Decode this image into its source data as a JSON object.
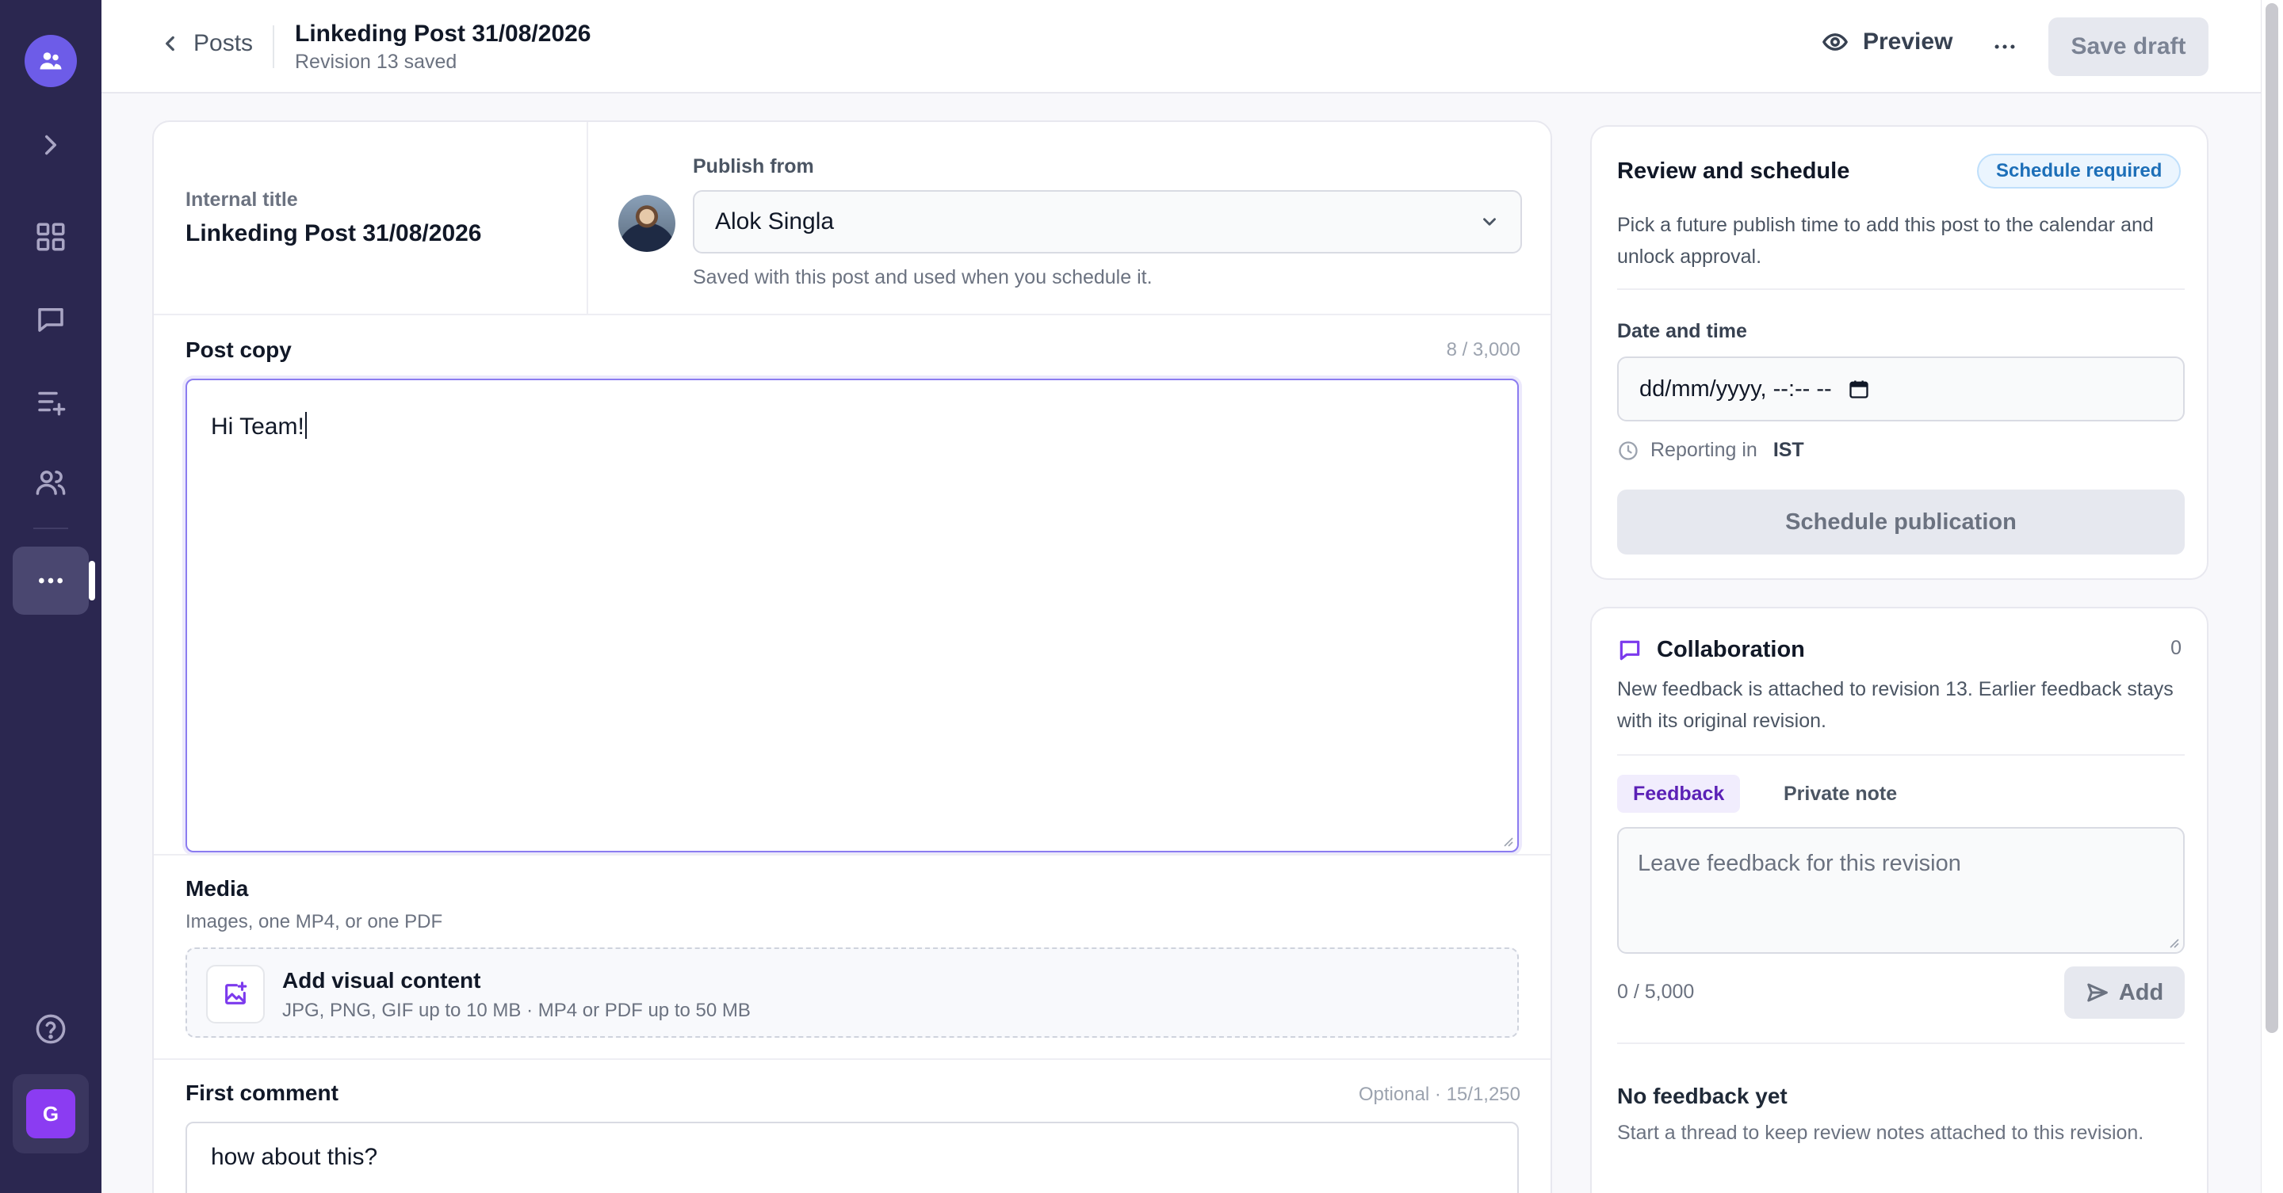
{
  "sidebar": {
    "brand_icon": "users-icon",
    "items": [
      {
        "name": "expand",
        "icon": "chevron-right-icon"
      },
      {
        "name": "dashboard",
        "icon": "grid-icon"
      },
      {
        "name": "messages",
        "icon": "chat-icon"
      },
      {
        "name": "queue",
        "icon": "list-add-icon"
      },
      {
        "name": "team",
        "icon": "users-icon"
      },
      {
        "name": "more",
        "icon": "more-horizontal-icon",
        "active": true
      }
    ],
    "help_icon": "help-circle-icon",
    "user_initial": "G",
    "user_color": "#8b3cf2",
    "sidebar_color": "#2b2750"
  },
  "topbar": {
    "back_label": "Posts",
    "title": "Linkeding Post 31/08/2026",
    "subtitle": "Revision 13 saved",
    "preview_label": "Preview",
    "save_label": "Save draft"
  },
  "editor": {
    "internal_title_label": "Internal title",
    "internal_title_value": "Linkeding Post 31/08/2026",
    "publish_from_label": "Publish from",
    "publish_from_value": "Alok Singla",
    "publish_from_hint": "Saved with this post and used when you schedule it.",
    "post_copy_label": "Post copy",
    "post_copy_count": "8 / 3,000",
    "post_copy_value": "Hi Team!",
    "media_label": "Media",
    "media_sub": "Images, one MP4, or one PDF",
    "media_add_title": "Add visual content",
    "media_add_sub": "JPG, PNG, GIF up to 10 MB · MP4 or PDF up to 50 MB",
    "first_comment_label": "First comment",
    "first_comment_count": "Optional · 15/1,250",
    "first_comment_value": "how about this?"
  },
  "review": {
    "title": "Review and schedule",
    "badge": "Schedule required",
    "description": "Pick a future publish time to add this post to the calendar and unlock approval.",
    "datetime_label": "Date and time",
    "datetime_placeholder": "dd/mm/yyyy, --:-- --",
    "reporting_prefix": "Reporting in",
    "reporting_tz": "IST",
    "schedule_button": "Schedule publication"
  },
  "collaboration": {
    "title": "Collaboration",
    "count": "0",
    "description": "New feedback is attached to revision 13. Earlier feedback stays with its original revision.",
    "tab_feedback": "Feedback",
    "tab_private": "Private note",
    "feedback_placeholder": "Leave feedback for this revision",
    "feedback_count": "0 / 5,000",
    "add_button": "Add",
    "empty_title": "No feedback yet",
    "empty_sub": "Start a thread to keep review notes attached to this revision."
  },
  "colors": {
    "accent": "#7c3aed",
    "focus_border": "#8b7cf0",
    "badge_text": "#1d6fb8"
  }
}
